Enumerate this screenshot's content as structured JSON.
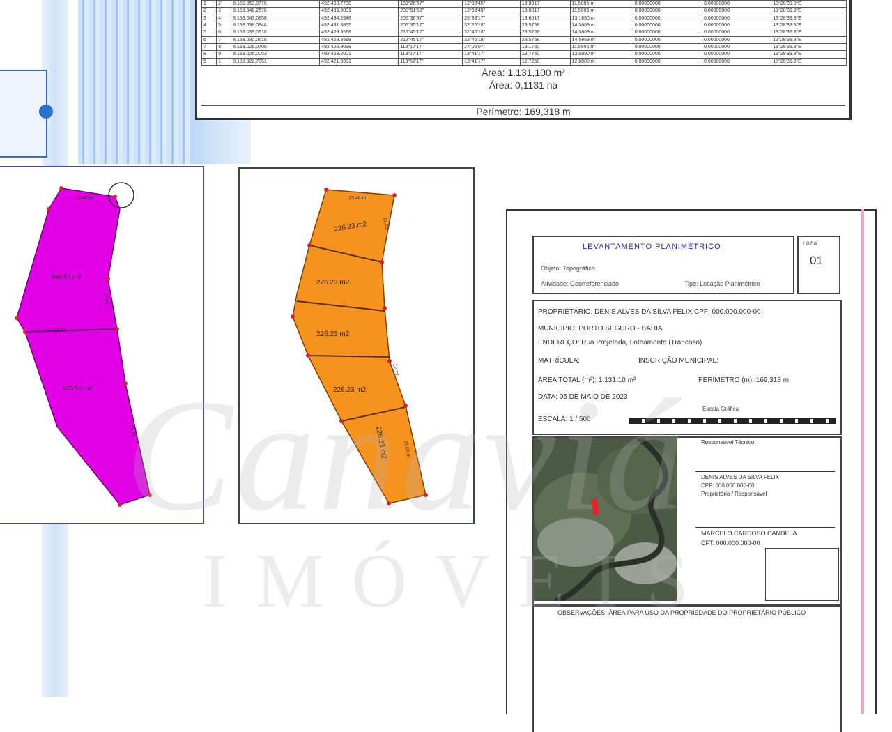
{
  "top_table": {
    "rows": [
      [
        "1",
        "2",
        "8.158.053,0778",
        "492.438.7738",
        "159°26'57\"",
        "13°38'45\"",
        "13,8017",
        "11,5895 m",
        "0.00000000",
        "0.00000000",
        "13°28'39.8\"E"
      ],
      [
        "2",
        "3",
        "8.158.048,2678",
        "492.436.8001",
        "200°51'53\"",
        "13°38'45\"",
        "13,8017",
        "11,5895 m",
        "0.00000000",
        "0.00000000",
        "13°28'39.8\"E"
      ],
      [
        "3",
        "4",
        "8.158.043,0858",
        "492.434.2848",
        "205°36'37\"",
        "26°38'17\"",
        "13,6017",
        "13,1890 m",
        "0.00000000",
        "0.00000000",
        "13°28'39.8\"E"
      ],
      [
        "4",
        "5",
        "8.158.038,0948",
        "492.431.3855",
        "205°35'17\"",
        "32°26'18\"",
        "23,5758",
        "14,5869 m",
        "0.00000000",
        "0.00000000",
        "13°28'39.8\"E"
      ],
      [
        "5",
        "6",
        "8.158.033,0918",
        "492.429.3568",
        "213°45'17\"",
        "32°46'18\"",
        "23,5758",
        "14,5869 m",
        "0.00000000",
        "0.00000000",
        "13°28'39.8\"E"
      ],
      [
        "6",
        "7",
        "8.158.030,0618",
        "492.428.3568",
        "213°45'17\"",
        "32°46'18\"",
        "23,5758",
        "14,5869 m",
        "0.00000000",
        "0.00000000",
        "13°28'39.8\"E"
      ],
      [
        "7",
        "8",
        "8.158.028,0708",
        "492.426.3038",
        "113°17'17\"",
        "27°06'07\"",
        "13,1750",
        "11,5895 m",
        "0.00000000",
        "0.00000000",
        "13°28'39.8\"E"
      ],
      [
        "8",
        "9",
        "8.158.025,0053",
        "492.423.2001",
        "113°17'17\"",
        "13°41'17\"",
        "13,7750",
        "13,5890 m",
        "0.00000000",
        "0.00000000",
        "13°28'39.8\"E"
      ],
      [
        "9",
        "1",
        "8.158.022,7051",
        "492.421.3301",
        "113°52'17\"",
        "13°41'17\"",
        "12,7250",
        "12,8000 m",
        "0.00000000",
        "0.00000000",
        "13°28'39.8\"E"
      ]
    ],
    "area_m2": "Área: 1.131,100 m²",
    "area_ha": "Área: 0,1131 ha",
    "perimeter": "Perímetro: 169,318 m"
  },
  "lots_purple": {
    "fill": "#e100e6",
    "area_labels": [
      "565,55 m2",
      "565,55 m2"
    ],
    "edge_labels": [
      "13,46 m",
      "15,51",
      "15,51",
      "13,75"
    ]
  },
  "lots_orange": {
    "fill": "#f6921e",
    "area_labels": [
      "226.23 m2",
      "226.23 m2",
      "226.23 m2",
      "226.23 m2",
      "226.23 m2"
    ],
    "edge_labels": [
      "13,46 m",
      "13,13",
      "12,72",
      "20,01 m"
    ]
  },
  "sheet": {
    "title": "LEVANTAMENTO PLANIMÉTRICO",
    "folha_label": "Folha",
    "folha_num": "01",
    "hdr_line1": "Objeto: Topográfico",
    "hdr_line2": "Atividade: Georreferenciado",
    "hdr_line3": "Tipo: Locação Planimétrico",
    "proprietario": "PROPRIETÁRIO: DENIS ALVES DA SILVA FELIX    CPF: 000.000.000-00",
    "municipio": "MUNICÍPIO: PORTO SEGURO - BAHIA",
    "endereco": "ENDEREÇO: Rua Projetada, Loteamento (Trancoso)",
    "matricula": "MATRÍCULA:",
    "inscricao": "INSCRIÇÃO MUNICIPAL:",
    "area_total": "ÁREA TOTAL (m²): 1.131,10 m²",
    "perimetro": "PERÍMETRO (m): 169,318 m",
    "data": "DATA: 05 DE MAIO DE 2023",
    "escala": "ESCALA: 1 / 500",
    "escala_grafica": "Escala Gráfica",
    "sig1_label": "Responsável Técnico",
    "sig1_name": "DENIS ALVES DA SILVA FELIX",
    "sig1_cpf": "CPF: 000.000.000-00",
    "sig1_role": "Proprietário / Responsável",
    "sig2_name": "MARCELO CARDOSO CANDELA",
    "sig2_crea": "CFT: 000.000.000-00",
    "obs": "OBSERVAÇÕES: ÁREA PARA USO DA PROPRIEDADE DO PROPRIETÁRIO PÚBLICO"
  },
  "watermark": {
    "main": "Canaviá",
    "sub": "IMÓVEIS"
  }
}
